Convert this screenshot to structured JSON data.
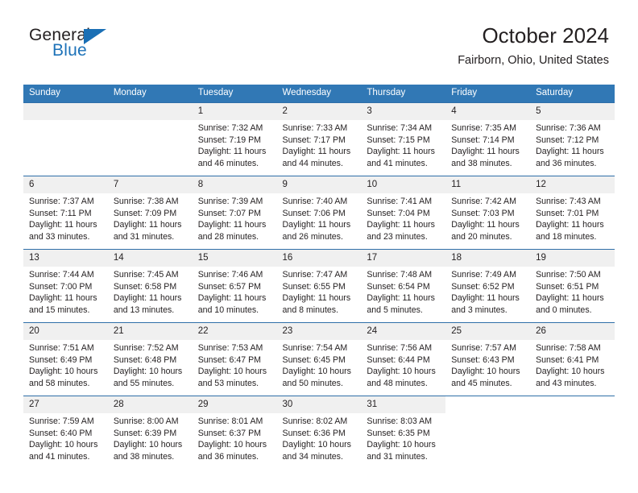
{
  "brand": {
    "line1": "General",
    "line2": "Blue",
    "triangle_icon": "triangle-icon",
    "colors": {
      "text": "#231f20",
      "blue": "#1d72b8"
    }
  },
  "header": {
    "title": "October 2024",
    "subtitle": "Fairborn, Ohio, United States"
  },
  "theme": {
    "header_bg": "#3178b5",
    "row_divider": "#2f6fa8",
    "daynum_bg": "#f0f0f0"
  },
  "calendar": {
    "weekday_headers": [
      "Sunday",
      "Monday",
      "Tuesday",
      "Wednesday",
      "Thursday",
      "Friday",
      "Saturday"
    ],
    "labels": {
      "sunrise": "Sunrise:",
      "sunset": "Sunset:",
      "daylight": "Daylight:"
    },
    "weeks": [
      [
        {
          "day": "",
          "blank": true,
          "outside": false
        },
        {
          "day": "",
          "blank": true,
          "outside": false
        },
        {
          "day": "1",
          "sunrise": "Sunrise: 7:32 AM",
          "sunset": "Sunset: 7:19 PM",
          "daylight": "Daylight: 11 hours and 46 minutes."
        },
        {
          "day": "2",
          "sunrise": "Sunrise: 7:33 AM",
          "sunset": "Sunset: 7:17 PM",
          "daylight": "Daylight: 11 hours and 44 minutes."
        },
        {
          "day": "3",
          "sunrise": "Sunrise: 7:34 AM",
          "sunset": "Sunset: 7:15 PM",
          "daylight": "Daylight: 11 hours and 41 minutes."
        },
        {
          "day": "4",
          "sunrise": "Sunrise: 7:35 AM",
          "sunset": "Sunset: 7:14 PM",
          "daylight": "Daylight: 11 hours and 38 minutes."
        },
        {
          "day": "5",
          "sunrise": "Sunrise: 7:36 AM",
          "sunset": "Sunset: 7:12 PM",
          "daylight": "Daylight: 11 hours and 36 minutes."
        }
      ],
      [
        {
          "day": "6",
          "sunrise": "Sunrise: 7:37 AM",
          "sunset": "Sunset: 7:11 PM",
          "daylight": "Daylight: 11 hours and 33 minutes."
        },
        {
          "day": "7",
          "sunrise": "Sunrise: 7:38 AM",
          "sunset": "Sunset: 7:09 PM",
          "daylight": "Daylight: 11 hours and 31 minutes."
        },
        {
          "day": "8",
          "sunrise": "Sunrise: 7:39 AM",
          "sunset": "Sunset: 7:07 PM",
          "daylight": "Daylight: 11 hours and 28 minutes."
        },
        {
          "day": "9",
          "sunrise": "Sunrise: 7:40 AM",
          "sunset": "Sunset: 7:06 PM",
          "daylight": "Daylight: 11 hours and 26 minutes."
        },
        {
          "day": "10",
          "sunrise": "Sunrise: 7:41 AM",
          "sunset": "Sunset: 7:04 PM",
          "daylight": "Daylight: 11 hours and 23 minutes."
        },
        {
          "day": "11",
          "sunrise": "Sunrise: 7:42 AM",
          "sunset": "Sunset: 7:03 PM",
          "daylight": "Daylight: 11 hours and 20 minutes."
        },
        {
          "day": "12",
          "sunrise": "Sunrise: 7:43 AM",
          "sunset": "Sunset: 7:01 PM",
          "daylight": "Daylight: 11 hours and 18 minutes."
        }
      ],
      [
        {
          "day": "13",
          "sunrise": "Sunrise: 7:44 AM",
          "sunset": "Sunset: 7:00 PM",
          "daylight": "Daylight: 11 hours and 15 minutes."
        },
        {
          "day": "14",
          "sunrise": "Sunrise: 7:45 AM",
          "sunset": "Sunset: 6:58 PM",
          "daylight": "Daylight: 11 hours and 13 minutes."
        },
        {
          "day": "15",
          "sunrise": "Sunrise: 7:46 AM",
          "sunset": "Sunset: 6:57 PM",
          "daylight": "Daylight: 11 hours and 10 minutes."
        },
        {
          "day": "16",
          "sunrise": "Sunrise: 7:47 AM",
          "sunset": "Sunset: 6:55 PM",
          "daylight": "Daylight: 11 hours and 8 minutes."
        },
        {
          "day": "17",
          "sunrise": "Sunrise: 7:48 AM",
          "sunset": "Sunset: 6:54 PM",
          "daylight": "Daylight: 11 hours and 5 minutes."
        },
        {
          "day": "18",
          "sunrise": "Sunrise: 7:49 AM",
          "sunset": "Sunset: 6:52 PM",
          "daylight": "Daylight: 11 hours and 3 minutes."
        },
        {
          "day": "19",
          "sunrise": "Sunrise: 7:50 AM",
          "sunset": "Sunset: 6:51 PM",
          "daylight": "Daylight: 11 hours and 0 minutes."
        }
      ],
      [
        {
          "day": "20",
          "sunrise": "Sunrise: 7:51 AM",
          "sunset": "Sunset: 6:49 PM",
          "daylight": "Daylight: 10 hours and 58 minutes."
        },
        {
          "day": "21",
          "sunrise": "Sunrise: 7:52 AM",
          "sunset": "Sunset: 6:48 PM",
          "daylight": "Daylight: 10 hours and 55 minutes."
        },
        {
          "day": "22",
          "sunrise": "Sunrise: 7:53 AM",
          "sunset": "Sunset: 6:47 PM",
          "daylight": "Daylight: 10 hours and 53 minutes."
        },
        {
          "day": "23",
          "sunrise": "Sunrise: 7:54 AM",
          "sunset": "Sunset: 6:45 PM",
          "daylight": "Daylight: 10 hours and 50 minutes."
        },
        {
          "day": "24",
          "sunrise": "Sunrise: 7:56 AM",
          "sunset": "Sunset: 6:44 PM",
          "daylight": "Daylight: 10 hours and 48 minutes."
        },
        {
          "day": "25",
          "sunrise": "Sunrise: 7:57 AM",
          "sunset": "Sunset: 6:43 PM",
          "daylight": "Daylight: 10 hours and 45 minutes."
        },
        {
          "day": "26",
          "sunrise": "Sunrise: 7:58 AM",
          "sunset": "Sunset: 6:41 PM",
          "daylight": "Daylight: 10 hours and 43 minutes."
        }
      ],
      [
        {
          "day": "27",
          "sunrise": "Sunrise: 7:59 AM",
          "sunset": "Sunset: 6:40 PM",
          "daylight": "Daylight: 10 hours and 41 minutes."
        },
        {
          "day": "28",
          "sunrise": "Sunrise: 8:00 AM",
          "sunset": "Sunset: 6:39 PM",
          "daylight": "Daylight: 10 hours and 38 minutes."
        },
        {
          "day": "29",
          "sunrise": "Sunrise: 8:01 AM",
          "sunset": "Sunset: 6:37 PM",
          "daylight": "Daylight: 10 hours and 36 minutes."
        },
        {
          "day": "30",
          "sunrise": "Sunrise: 8:02 AM",
          "sunset": "Sunset: 6:36 PM",
          "daylight": "Daylight: 10 hours and 34 minutes."
        },
        {
          "day": "31",
          "sunrise": "Sunrise: 8:03 AM",
          "sunset": "Sunset: 6:35 PM",
          "daylight": "Daylight: 10 hours and 31 minutes."
        },
        {
          "day": "",
          "blank": true,
          "outside": true
        },
        {
          "day": "",
          "blank": true,
          "outside": true
        }
      ]
    ]
  }
}
